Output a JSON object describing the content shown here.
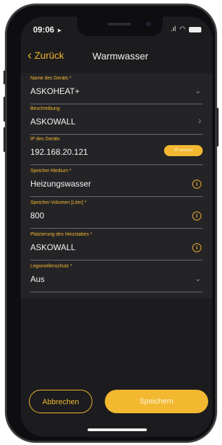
{
  "status": {
    "time": "09:06",
    "signal": ".ıl"
  },
  "nav": {
    "back_label": "Zurück",
    "title": "Warmwasser"
  },
  "fields": [
    {
      "label": "Name des Geräts *",
      "value": "ASKOHEAT+",
      "icon": "chevron-down-icon"
    },
    {
      "label": "Beschreibung",
      "value": "ASKOWALL",
      "icon": "chevron-right-icon"
    },
    {
      "label": "IP des Geräts",
      "value": "192.168.20.121",
      "button": "IP suchen"
    },
    {
      "label": "Speicher-Medium *",
      "value": "Heizungswasser",
      "icon": "info-icon"
    },
    {
      "label": "Speicher-Volumen [Liter] *",
      "value": "800",
      "icon": "info-icon"
    },
    {
      "label": "Platzierung des Heizstabes *",
      "value": "ASKOWALL",
      "icon": "info-icon"
    },
    {
      "label": "Legionellenschutz *",
      "value": "Aus",
      "icon": "chevron-down-icon"
    }
  ],
  "actions": {
    "cancel": "Abbrechen",
    "save": "Speichern"
  },
  "colors": {
    "accent": "#f2b830",
    "background": "#1c1c1e",
    "form": "#242427"
  }
}
